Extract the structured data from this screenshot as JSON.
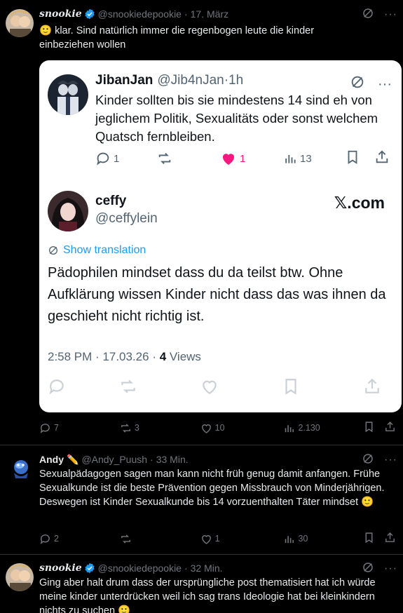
{
  "post1": {
    "author_name": "snookie",
    "handle": "@snookiedepookie",
    "separator": "·",
    "time": "17. März",
    "text": "🙂 klar. Sind natürlich immer die regenbogen leute die kinder einbeziehen wollen",
    "quote": {
      "author_name": "JibanJan",
      "handle": "@Jib4nJan",
      "separator": "·",
      "time": "1h",
      "text": "Kinder sollten bis sie mindestens 14 sind eh von jeglichem Politik, Sexualitäts oder sonst welchem Quatsch fernbleiben.",
      "replies": "1",
      "likes": "1",
      "views": "13",
      "reply_author_name": "ceffy",
      "reply_handle": "@ceffylein",
      "source": "𝕏.com",
      "translate_label": "Show translation",
      "reply_text": "Pädophilen mindset dass du da teilst btw. Ohne Aufklärung wissen Kinder nicht dass das was ihnen da geschieht nicht richtig ist.",
      "meta_time": "2:58 PM · 17.03.26 · ",
      "meta_views_count": "4",
      "meta_views_label": " Views"
    },
    "replies": "7",
    "reposts": "3",
    "likes": "10",
    "views": "2.130"
  },
  "post2": {
    "author_name": "Andy",
    "emoji": "✏️",
    "handle": "@Andy_Puush",
    "separator": "·",
    "time": "33 Min.",
    "text": "Sexualpädagogen sagen man kann nicht früh genug damit anfangen. Frühe Sexualkunde ist die beste Prävention gegen Missbrauch von Minderjährigen. Deswegen ist Kinder Sexualkunde bis 14 vorzuenthalten Täter mindset 🙂",
    "replies": "2",
    "likes": "1",
    "views": "30"
  },
  "post3": {
    "author_name": "snookie",
    "handle": "@snookiedepookie",
    "separator": "·",
    "time": "32 Min.",
    "text": "Ging aber halt drum dass der ursprüngliche post thematisiert hat ich würde meine kinder unterdrücken weil ich sag trans Ideologie hat bei kleinkindern nichts zu suchen 🙂"
  },
  "colors": {
    "background": "#000000",
    "text": "#e7e9ea",
    "muted": "#71767b",
    "verified": "#1d9bf0",
    "like_active": "#f91880",
    "card_bg": "#ffffff"
  }
}
